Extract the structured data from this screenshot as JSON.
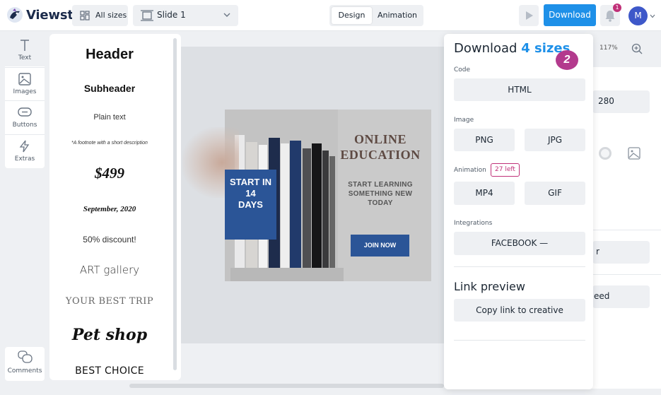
{
  "app": {
    "name": "Viewst"
  },
  "toolbar": {
    "all_sizes_label": "All sizes",
    "slide_label": "Slide 1",
    "design_tab": "Design",
    "animation_tab": "Animation",
    "download_label": "Download",
    "notification_count": "1",
    "avatar_initial": "M"
  },
  "tools": [
    {
      "label": "Text",
      "icon": "text-icon"
    },
    {
      "label": "Images",
      "icon": "image-icon"
    },
    {
      "label": "Buttons",
      "icon": "button-icon"
    },
    {
      "label": "Extras",
      "icon": "lightning-icon"
    }
  ],
  "comments_label": "Comments",
  "text_presets": {
    "header": "Header",
    "subheader": "Subheader",
    "plain": "Plain text",
    "footnote": "*A footnote with a short description",
    "price": "$499",
    "date": "September, 2020",
    "discount": "50% discount!",
    "art": "ART gallery",
    "trip": "YOUR BEST TRIP",
    "pet": "Pet shop",
    "best": "BEST CHOICE"
  },
  "creative": {
    "start_text": "START IN\n14\nDAYS",
    "title": "ONLINE\nEDUCATION",
    "subtitle": "START LEARNING\nSOMETHING NEW\nTODAY",
    "cta": "JOIN NOW"
  },
  "properties": {
    "zoom": "117%",
    "width_value": "280",
    "button1_partial": "r",
    "button2_partial": "eed"
  },
  "download_popup": {
    "title_prefix": "Download",
    "title_highlight": "4 sizes",
    "step_number": "2",
    "code_label": "Code",
    "html_button": "HTML",
    "image_label": "Image",
    "png_button": "PNG",
    "jpg_button": "JPG",
    "animation_label": "Animation",
    "animation_left_badge": "27 left",
    "mp4_button": "MP4",
    "gif_button": "GIF",
    "integrations_label": "Integrations",
    "facebook_button": "FACEBOOK —",
    "link_preview_title": "Link preview",
    "copy_link_button": "Copy link to creative"
  },
  "colors": {
    "accent": "#1e90e8",
    "badge": "#c03078",
    "step_badge": "#b33a8d",
    "creative_blue": "#2b5597"
  }
}
